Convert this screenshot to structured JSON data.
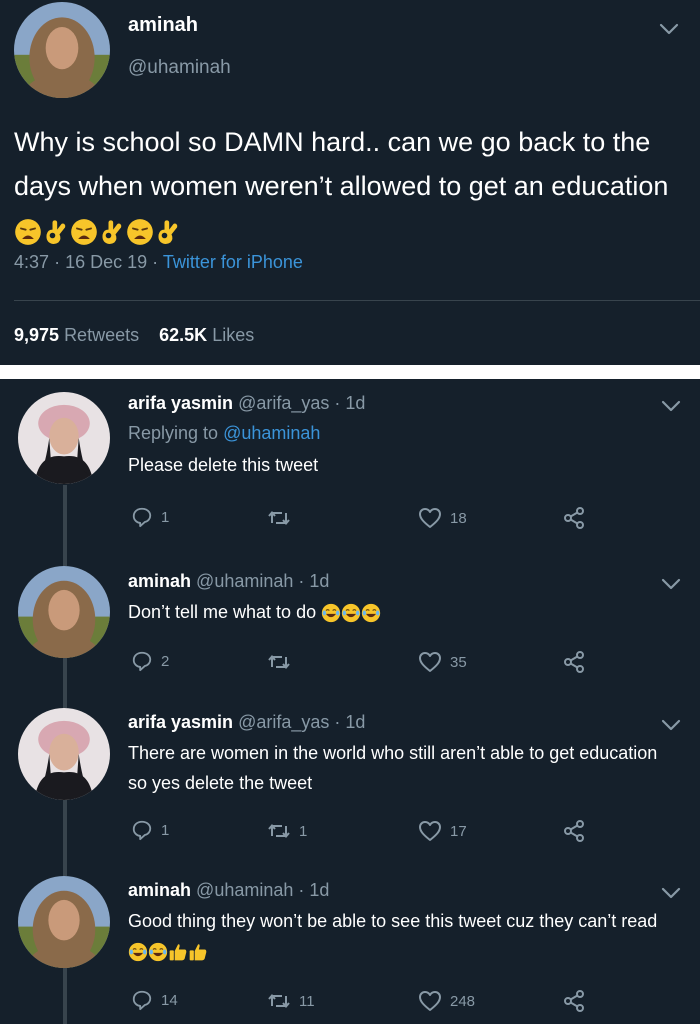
{
  "main_tweet": {
    "name": "aminah",
    "handle": "@uhaminah",
    "text": "Why is school so DAMN hard.. can we go back to the days when women weren’t allowed to get an education",
    "time": "4:37",
    "date": "16 Dec 19",
    "source": "Twitter for iPhone",
    "retweets": "9,975",
    "retweets_label": "Retweets",
    "likes": "62.5K",
    "likes_label": "Likes"
  },
  "replies": [
    {
      "name": "arifa yasmin",
      "handle": "@arifa_yas",
      "age": "1d",
      "replying_prefix": "Replying to",
      "replying_handle": "@uhaminah",
      "text": "Please delete this tweet",
      "replies": "1",
      "retweets": "",
      "likes": "18"
    },
    {
      "name": "aminah",
      "handle": "@uhaminah",
      "age": "1d",
      "text": "Don’t tell me what to do",
      "replies": "2",
      "retweets": "",
      "likes": "35"
    },
    {
      "name": "arifa yasmin",
      "handle": "@arifa_yas",
      "age": "1d",
      "text": "There are women in the world who still aren’t able to get education so yes delete the tweet",
      "replies": "1",
      "retweets": "1",
      "likes": "17"
    },
    {
      "name": "aminah",
      "handle": "@uhaminah",
      "age": "1d",
      "text": "Good thing they won’t be able to see this tweet cuz they can’t read",
      "replies": "14",
      "retweets": "11",
      "likes": "248"
    }
  ],
  "separators": {
    "dot": "·"
  },
  "colors": {
    "background": "#15202b",
    "muted": "#8899a6",
    "link": "#3b94d9",
    "divider": "#38444d"
  },
  "icons": {
    "reply": "reply-icon",
    "retweet": "retweet-icon",
    "like": "heart-icon",
    "share": "share-icon",
    "menu": "chevron-down-icon",
    "emoji_weary": "weary-face-emoji",
    "emoji_ok": "ok-hand-emoji",
    "emoji_laugh": "tears-of-joy-emoji",
    "emoji_thumbs": "thumbs-up-emoji"
  }
}
